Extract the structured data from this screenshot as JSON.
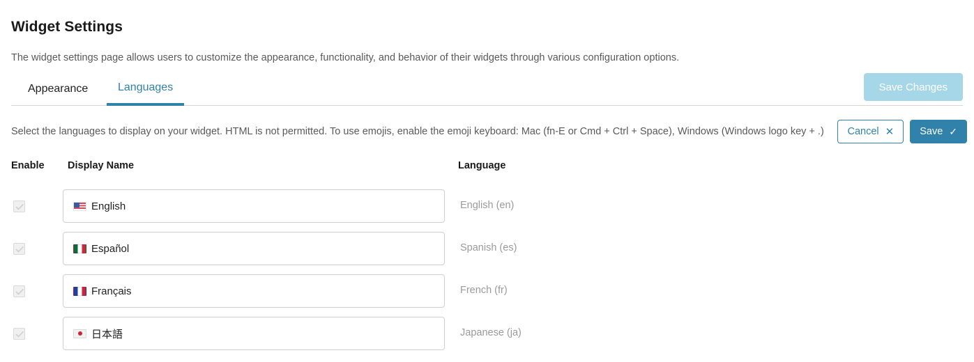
{
  "header": {
    "title": "Widget Settings",
    "description": "The widget settings page allows users to customize the appearance, functionality, and behavior of their widgets through various configuration options."
  },
  "tabs": [
    {
      "label": "Appearance",
      "active": false
    },
    {
      "label": "Languages",
      "active": true
    }
  ],
  "toolbar": {
    "save_changes_label": "Save Changes",
    "save_changes_disabled": true
  },
  "panel": {
    "instruction": "Select the languages to display on your widget. HTML is not permitted. To use emojis, enable the emoji keyboard: Mac (fn-E or Cmd + Ctrl + Space), Windows (Windows logo key + .)",
    "cancel_label": "Cancel",
    "cancel_icon": "close-icon",
    "cancel_glyph": "✕",
    "save_label": "Save",
    "save_icon": "check-icon",
    "save_glyph": "✓"
  },
  "table": {
    "columns": {
      "enable": "Enable",
      "display_name": "Display Name",
      "language": "Language"
    },
    "rows": [
      {
        "enabled": true,
        "flag": "flag-us",
        "flag_name": "flag-united-states-icon",
        "display_name": "English",
        "language": "English (en)"
      },
      {
        "enabled": true,
        "flag": "flag-mx",
        "flag_name": "flag-mexico-icon",
        "display_name": "Español",
        "language": "Spanish (es)"
      },
      {
        "enabled": true,
        "flag": "flag-fr",
        "flag_name": "flag-france-icon",
        "display_name": "Français",
        "language": "French (fr)"
      },
      {
        "enabled": true,
        "flag": "flag-jp",
        "flag_name": "flag-japan-icon",
        "display_name": "日本語",
        "language": "Japanese (ja)"
      }
    ]
  },
  "colors": {
    "accent": "#3182ab",
    "accent_disabled": "#a6d7e8",
    "text_primary": "#1a1a1a",
    "text_muted": "#9a9a9a",
    "border": "#cfcfcf"
  }
}
